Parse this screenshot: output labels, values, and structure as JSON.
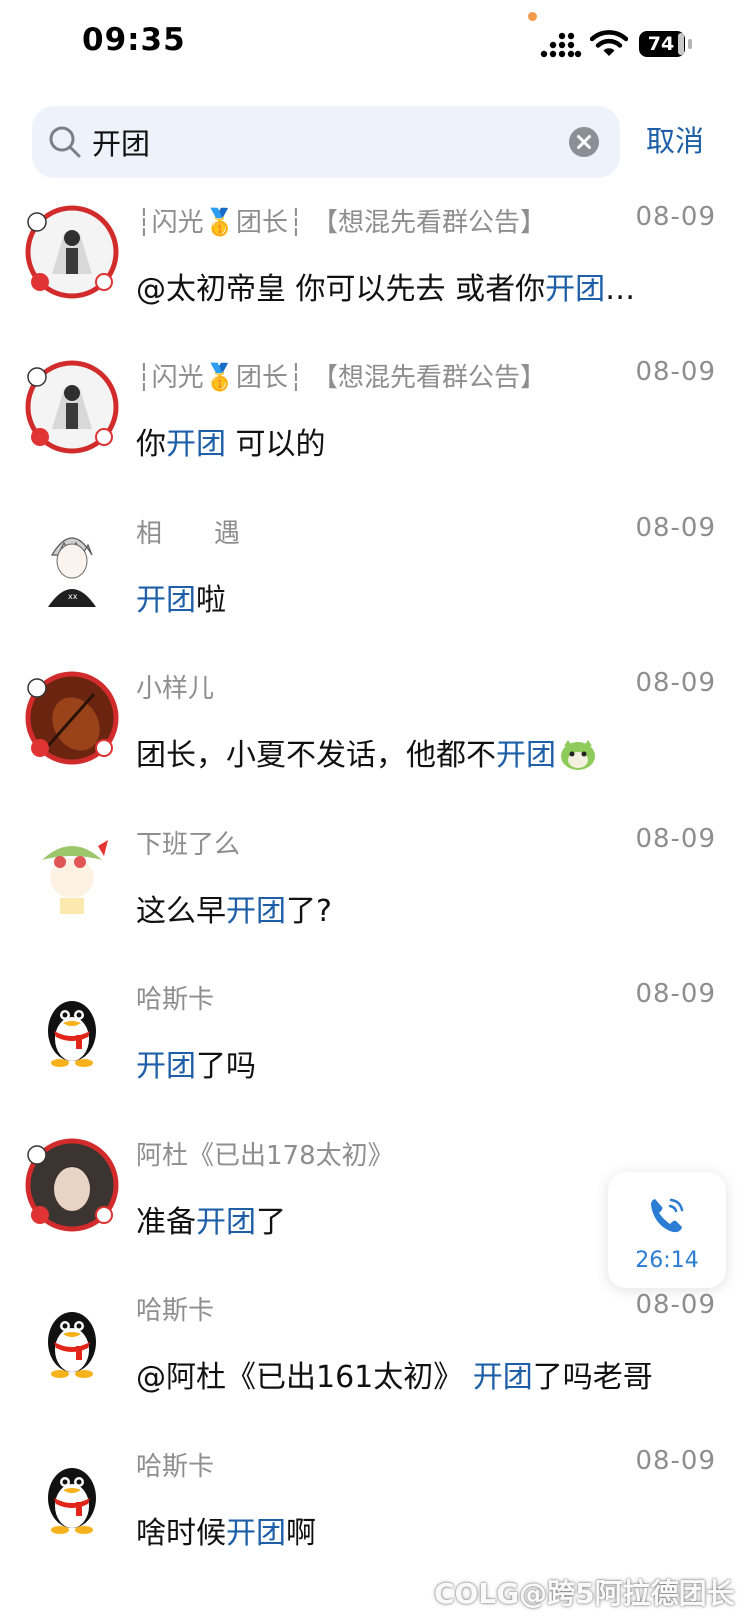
{
  "status_bar": {
    "time": "09:35",
    "battery_level": "74"
  },
  "search": {
    "query": "开团",
    "cancel_label": "取消"
  },
  "results": [
    {
      "sender_pre": "┆闪光",
      "sender_medal": "🥇",
      "sender_post": "团长┆ 【想混先看群公告】",
      "time": "08-09",
      "msg_before": "@太初帝皇  你可以先去 或者你",
      "msg_keyword": "开团",
      "msg_after": "…"
    },
    {
      "sender_pre": "┆闪光",
      "sender_medal": "🥇",
      "sender_post": "团长┆ 【想混先看群公告】",
      "time": "08-09",
      "msg_before": "你",
      "msg_keyword": "开团",
      "msg_after": " 可以的"
    },
    {
      "sender": "相　　遇",
      "time": "08-09",
      "msg_before": "",
      "msg_keyword": "开团",
      "msg_after": "啦"
    },
    {
      "sender": "小样儿",
      "time": "08-09",
      "msg_before": "团长，小夏不发话，他都不",
      "msg_keyword": "开团",
      "msg_after": ""
    },
    {
      "sender": "下班了么",
      "time": "08-09",
      "msg_before": "这么早",
      "msg_keyword": "开团",
      "msg_after": "了?"
    },
    {
      "sender": "哈斯卡",
      "time": "08-09",
      "msg_before": "",
      "msg_keyword": "开团",
      "msg_after": "了吗"
    },
    {
      "sender": "阿杜《已出178太初》",
      "time": "",
      "msg_before": "准备",
      "msg_keyword": "开团",
      "msg_after": "了"
    },
    {
      "sender": "哈斯卡",
      "time": "08-09",
      "msg_before": "@阿杜《已出161太初》  ",
      "msg_keyword": "开团",
      "msg_after": "了吗老哥"
    },
    {
      "sender": "哈斯卡",
      "time": "08-09",
      "msg_before": "啥时候",
      "msg_keyword": "开团",
      "msg_after": "啊"
    }
  ],
  "call": {
    "duration": "26:14"
  },
  "watermark": "COLG@跨5阿拉德团长",
  "colors": {
    "highlight": "#1e5fa8",
    "meta_text": "#8e8e8e",
    "call_accent": "#2b7cd3",
    "search_bg": "#eef2fb"
  }
}
